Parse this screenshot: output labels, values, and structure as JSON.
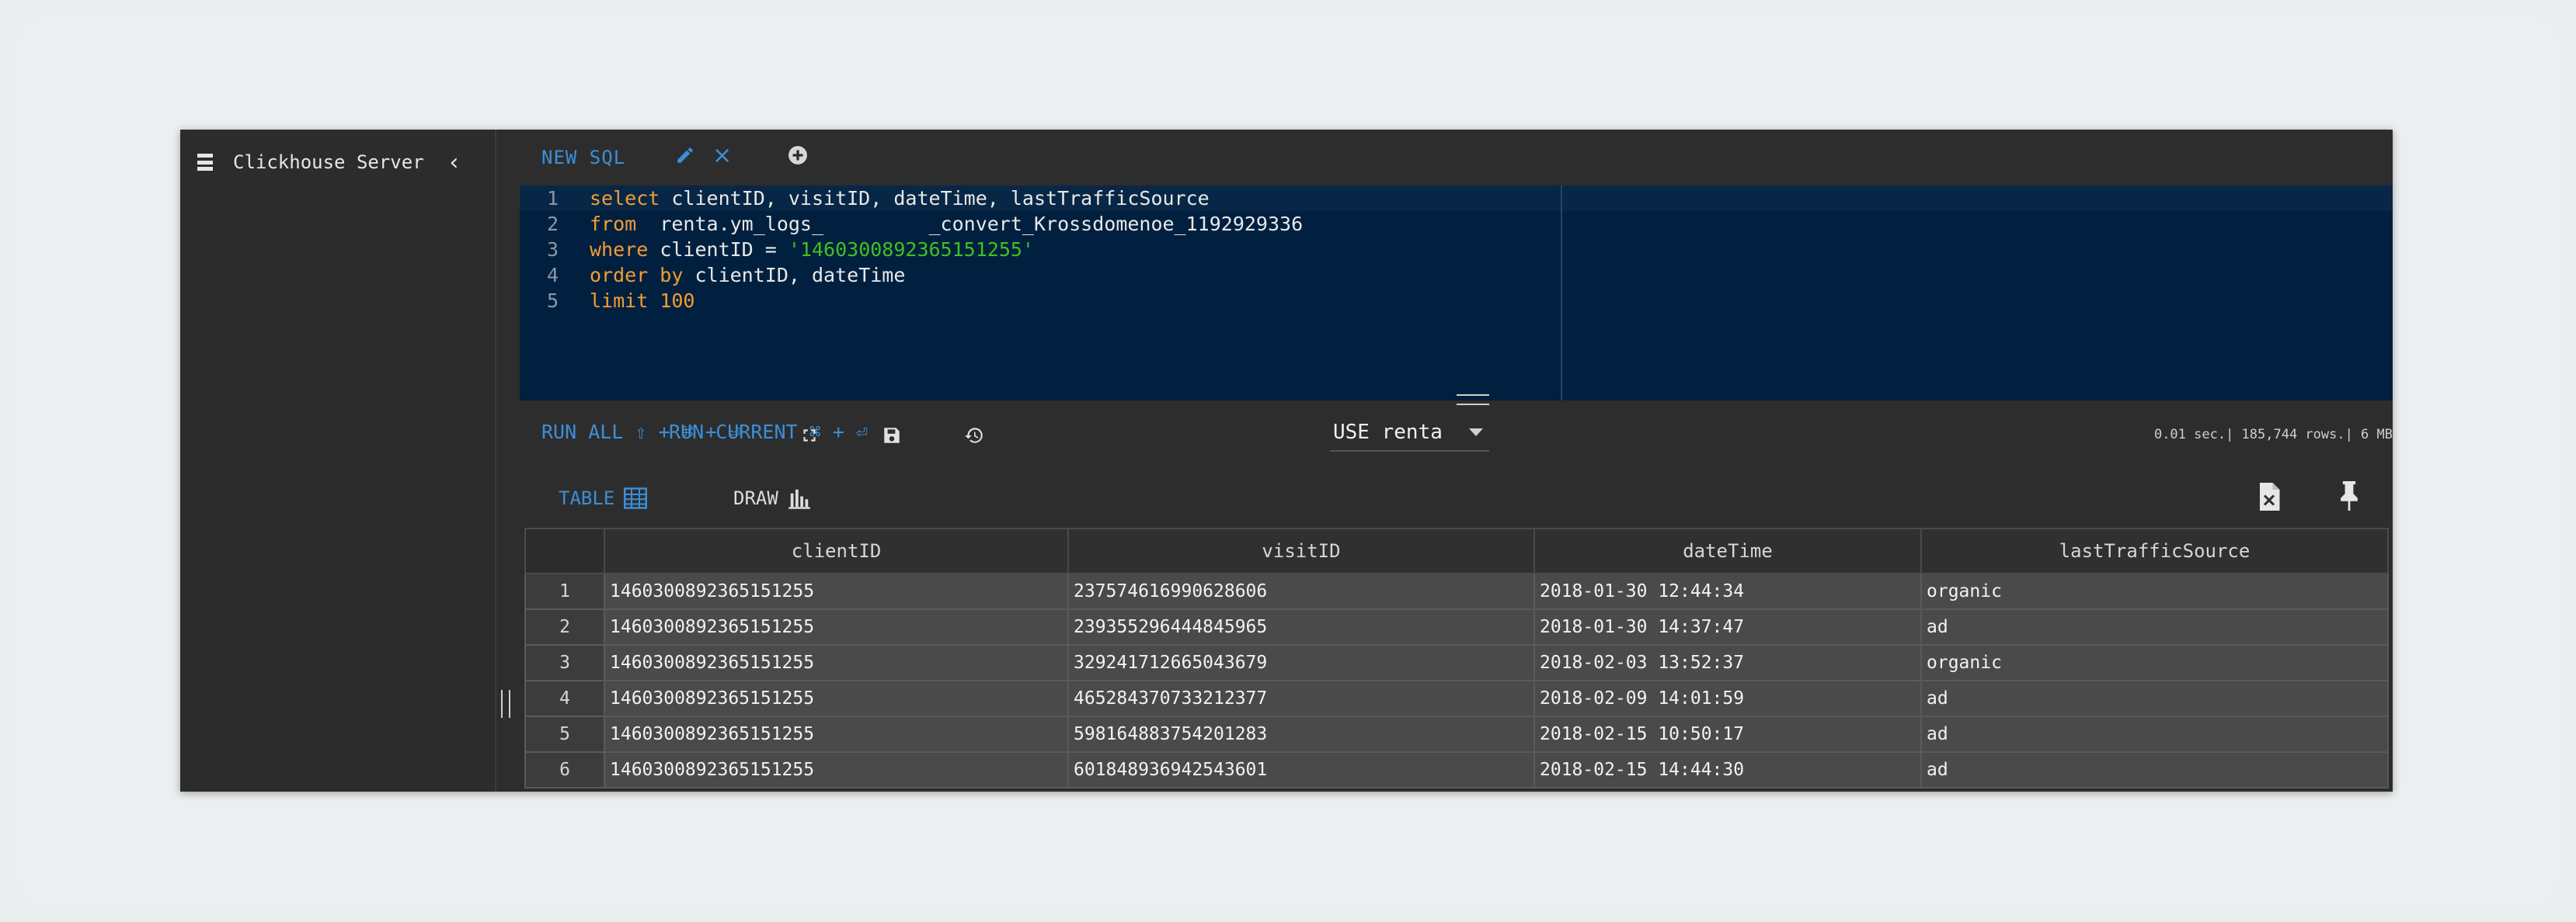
{
  "sidebar": {
    "title": "Clickhouse Server"
  },
  "tabs": [
    {
      "label": "NEW SQL"
    }
  ],
  "editor": {
    "lines": [
      {
        "n": "1",
        "tokens": [
          [
            "kw",
            "select"
          ],
          [
            "t",
            " clientID, visitID, dateTime, lastTrafficSource"
          ]
        ]
      },
      {
        "n": "2",
        "tokens": [
          [
            "kw",
            "from"
          ],
          [
            "t",
            "  renta.ym_logs_         _convert_Krossdomenoe_1192929336"
          ]
        ]
      },
      {
        "n": "3",
        "tokens": [
          [
            "kw",
            "where"
          ],
          [
            "t",
            " clientID = "
          ],
          [
            "str",
            "'1460300892365151255'"
          ]
        ]
      },
      {
        "n": "4",
        "tokens": [
          [
            "kw",
            "order by"
          ],
          [
            "t",
            " clientID, dateTime"
          ]
        ]
      },
      {
        "n": "5",
        "tokens": [
          [
            "kw",
            "limit"
          ],
          [
            "t",
            " "
          ],
          [
            "num",
            "100"
          ]
        ]
      }
    ]
  },
  "toolbar": {
    "run_all": "RUN ALL ⇧ + ⌘ + ⏎",
    "run_current": "RUN CURRENT ⌘ + ⏎",
    "database_select": "USE renta",
    "stats": "0.01 sec.| 185,744 rows.| 6 MB"
  },
  "result_tabs": {
    "table": "TABLE",
    "draw": "DRAW"
  },
  "results": {
    "columns": [
      "clientID",
      "visitID",
      "dateTime",
      "lastTrafficSource"
    ],
    "rows": [
      [
        "1",
        "1460300892365151255",
        "237574616990628606",
        "2018-01-30 12:44:34",
        "organic"
      ],
      [
        "2",
        "1460300892365151255",
        "239355296444845965",
        "2018-01-30 14:37:47",
        "ad"
      ],
      [
        "3",
        "1460300892365151255",
        "329241712665043679",
        "2018-02-03 13:52:37",
        "organic"
      ],
      [
        "4",
        "1460300892365151255",
        "465284370733212377",
        "2018-02-09 14:01:59",
        "ad"
      ],
      [
        "5",
        "1460300892365151255",
        "598164883754201283",
        "2018-02-15 10:50:17",
        "ad"
      ],
      [
        "6",
        "1460300892365151255",
        "601848936942543601",
        "2018-02-15 14:44:30",
        "ad"
      ]
    ]
  },
  "colors": {
    "accent": "#3b8fd9",
    "editor_bg": "#01203f",
    "keyword": "#f39c32",
    "string": "#40c020"
  }
}
